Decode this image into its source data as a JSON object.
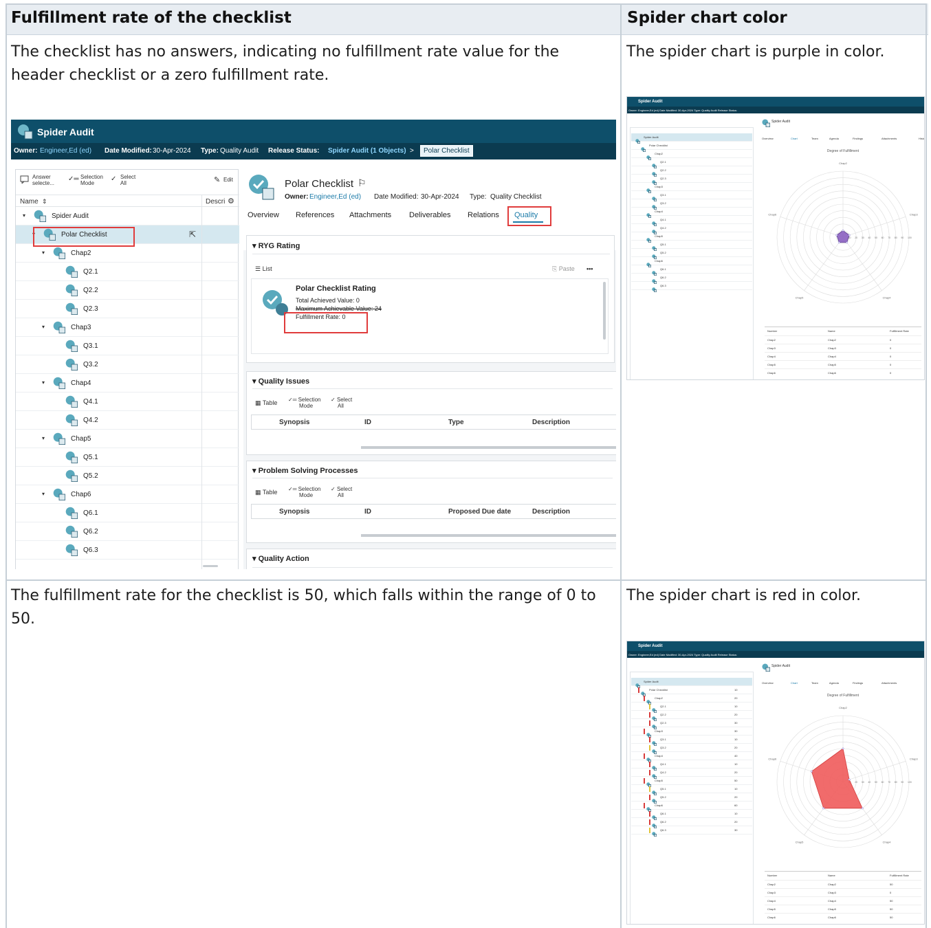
{
  "table": {
    "col1_header": "Fulfillment rate of the checklist",
    "col2_header": "Spider chart color",
    "row1_text": "The checklist has no answers, indicating no fulfillment rate value for the header checklist or a zero fulfillment rate.",
    "row1_color_text": "The spider chart is purple in color.",
    "row2_text": "The fulfillment rate for the checklist is 50, which falls within the range of 0 to 50.",
    "row2_color_text": "The spider chart is red in color."
  },
  "screenshot1": {
    "app_title": "Spider Audit",
    "owner_label": "Owner:",
    "owner_value": "Engineer,Ed (ed)",
    "date_label": "Date Modified:",
    "date_value": "30-Apr-2024",
    "type_label": "Type:",
    "type_value": "Quality Audit",
    "release_label": "Release Status:",
    "breadcrumb_1": "Spider Audit (1 Objects)",
    "breadcrumb_sep": ">",
    "breadcrumb_2": "Polar Checklist",
    "toolbar": {
      "answer": "Answer",
      "answer2": "selecte...",
      "selection": "Selection",
      "selection2": "Mode",
      "select": "Select",
      "select2": "All",
      "edit": "Edit"
    },
    "tree_header": {
      "name": "Name",
      "descr": "Descri"
    },
    "tree": [
      {
        "label": "Spider Audit",
        "level": 0
      },
      {
        "label": "Polar Checklist",
        "level": 1
      },
      {
        "label": "Chap2",
        "level": 2
      },
      {
        "label": "Q2.1",
        "level": 3
      },
      {
        "label": "Q2.2",
        "level": 3
      },
      {
        "label": "Q2.3",
        "level": 3
      },
      {
        "label": "Chap3",
        "level": 2
      },
      {
        "label": "Q3.1",
        "level": 3
      },
      {
        "label": "Q3.2",
        "level": 3
      },
      {
        "label": "Chap4",
        "level": 2
      },
      {
        "label": "Q4.1",
        "level": 3
      },
      {
        "label": "Q4.2",
        "level": 3
      },
      {
        "label": "Chap5",
        "level": 2
      },
      {
        "label": "Q5.1",
        "level": 3
      },
      {
        "label": "Q5.2",
        "level": 3
      },
      {
        "label": "Chap6",
        "level": 2
      },
      {
        "label": "Q6.1",
        "level": 3
      },
      {
        "label": "Q6.2",
        "level": 3
      },
      {
        "label": "Q6.3",
        "level": 3
      }
    ],
    "detail": {
      "title": "Polar Checklist",
      "owner_label": "Owner:",
      "owner_value": "Engineer,Ed (ed)",
      "date_label": "Date Modified:",
      "date_value": "30-Apr-2024",
      "type_label": "Type:",
      "type_value": "Quality Checklist",
      "tabs": [
        "Overview",
        "References",
        "Attachments",
        "Deliverables",
        "Relations",
        "Quality"
      ],
      "ryg_title": "RYG Rating",
      "list_label": "List",
      "paste_label": "Paste",
      "more_label": "•••",
      "rating_title": "Polar Checklist Rating",
      "total_achieved": "Total Achieved Value:  0",
      "max_achievable": "Maximum Achievable Value:  24",
      "fulfillment": "Fulfillment Rate:  0",
      "issues_title": "Quality Issues",
      "table_label": "Table",
      "issues_cols": [
        "Synopsis",
        "ID",
        "Type",
        "Description"
      ],
      "psp_title": "Problem Solving Processes",
      "psp_cols": [
        "Synopsis",
        "ID",
        "Proposed Due date",
        "Description"
      ],
      "action_title": "Quality Action"
    }
  },
  "mini_chart": {
    "app_title": "Spider Audit",
    "chart_title": "Degree of Fulfillment",
    "axes": [
      "Chap2",
      "Chap3",
      "Chap4",
      "Chap5",
      "Chap6"
    ],
    "ticks": [
      "10",
      "20",
      "30",
      "40",
      "50",
      "60",
      "70",
      "80",
      "90",
      "100"
    ],
    "tabs": [
      "Overview",
      "Chart",
      "Team",
      "Agenda",
      "Findings",
      "Attachments",
      "History"
    ],
    "tabs2": [
      "Overview",
      "Chart",
      "Team",
      "Agenda",
      "Findings",
      "Attachments"
    ],
    "table_cols": [
      "Number",
      "Name",
      "Fulfillment Rate"
    ],
    "owner_line": "Owner: Engineer,Ed (ed)    Date Modified: 30-Apr-2024    Type: Quality Audit    Release Status:",
    "tree_labels": [
      "Spider Audit",
      "Polar Checklist",
      "Chap2",
      "Q2.1",
      "Q2.2",
      "Q2.3",
      "Chap3",
      "Q3.1",
      "Q3.2",
      "Chap4",
      "Q4.1",
      "Q4.2",
      "Chap5",
      "Q5.1",
      "Q5.2",
      "Chap6",
      "Q6.1",
      "Q6.2",
      "Q6.3"
    ],
    "order_ids": [
      "",
      "10",
      "20",
      "10",
      "20",
      "30",
      "30",
      "10",
      "20",
      "40",
      "10",
      "20",
      "50",
      "10",
      "20",
      "60",
      "10",
      "20",
      "30"
    ]
  },
  "chart_data": [
    {
      "type": "radar",
      "title": "Degree of Fulfillment",
      "categories": [
        "Chap2",
        "Chap3",
        "Chap4",
        "Chap5",
        "Chap6"
      ],
      "values": [
        0,
        0,
        0,
        0,
        0
      ],
      "range": [
        0,
        100
      ],
      "color": "#8a5fc0"
    },
    {
      "type": "radar",
      "title": "Degree of Fulfillment",
      "categories": [
        "Chap2",
        "Chap3",
        "Chap4",
        "Chap5",
        "Chap6"
      ],
      "values": [
        50,
        0,
        50,
        50,
        50
      ],
      "range": [
        0,
        100
      ],
      "color": "#ef5b5b"
    }
  ],
  "mini_table1": [
    [
      "Chap2",
      "Chap2",
      "0"
    ],
    [
      "Chap3",
      "Chap3",
      "0"
    ],
    [
      "Chap4",
      "Chap4",
      "0"
    ],
    [
      "Chap5",
      "Chap5",
      "0"
    ],
    [
      "Chap6",
      "Chap6",
      "0"
    ]
  ],
  "mini_table2": [
    [
      "Chap2",
      "Chap2",
      "50"
    ],
    [
      "Chap3",
      "Chap3",
      "0"
    ],
    [
      "Chap4",
      "Chap4",
      "50"
    ],
    [
      "Chap5",
      "Chap5",
      "50"
    ],
    [
      "Chap6",
      "Chap6",
      "50"
    ]
  ]
}
